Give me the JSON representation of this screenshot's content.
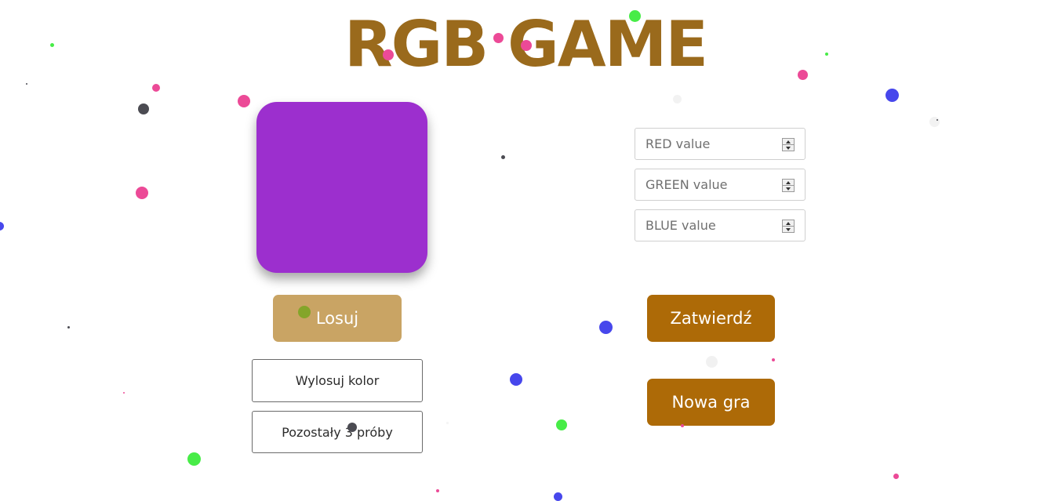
{
  "title": "RGB GAME",
  "target_color": "#9c2fce",
  "buttons": {
    "losuj": "Losuj",
    "zatwierdz": "Zatwierdź",
    "nowa_gra": "Nowa gra",
    "wylosuj_kolor": "Wylosuj kolor",
    "pozostaly": "Pozostały 3 próby"
  },
  "inputs": {
    "red_placeholder": "RED value",
    "green_placeholder": "GREEN value",
    "blue_placeholder": "BLUE value",
    "red_value": "",
    "green_value": "",
    "blue_value": ""
  },
  "colors": {
    "title": "#9a6a1c",
    "losuj_button": "#c9a464",
    "primary_button": "#ad6a07",
    "particle_pink": "#ec4a97",
    "particle_blue": "#4747ec",
    "particle_green": "#47ec47",
    "particle_dark": "#4b4b52",
    "particle_olive": "#84a52a"
  },
  "icons": {
    "spinner": "up-down-arrows-icon",
    "particles": "confetti-dot-icon"
  }
}
